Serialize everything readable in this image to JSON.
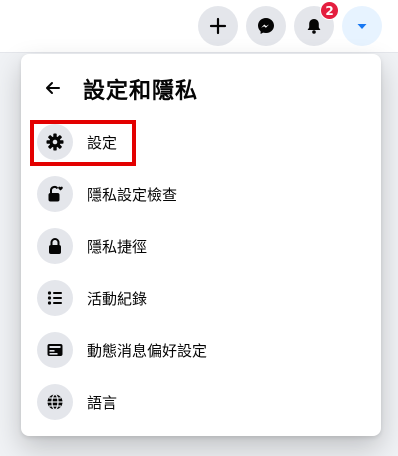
{
  "topbar": {
    "create_icon": "plus-icon",
    "messenger_icon": "messenger-icon",
    "notifications_icon": "bell-icon",
    "notifications_count": "2",
    "account_icon": "caret-down-icon"
  },
  "panel": {
    "title": "設定和隱私",
    "back_icon": "arrow-left-icon",
    "items": [
      {
        "label": "設定",
        "icon": "gear-icon"
      },
      {
        "label": "隱私設定檢查",
        "icon": "lock-heart-icon"
      },
      {
        "label": "隱私捷徑",
        "icon": "lock-icon"
      },
      {
        "label": "活動紀錄",
        "icon": "list-icon"
      },
      {
        "label": "動態消息偏好設定",
        "icon": "feed-icon"
      },
      {
        "label": "語言",
        "icon": "globe-icon"
      }
    ]
  },
  "colors": {
    "accent": "#1877f2",
    "highlight": "#e30000",
    "badge": "#e41e3f"
  }
}
